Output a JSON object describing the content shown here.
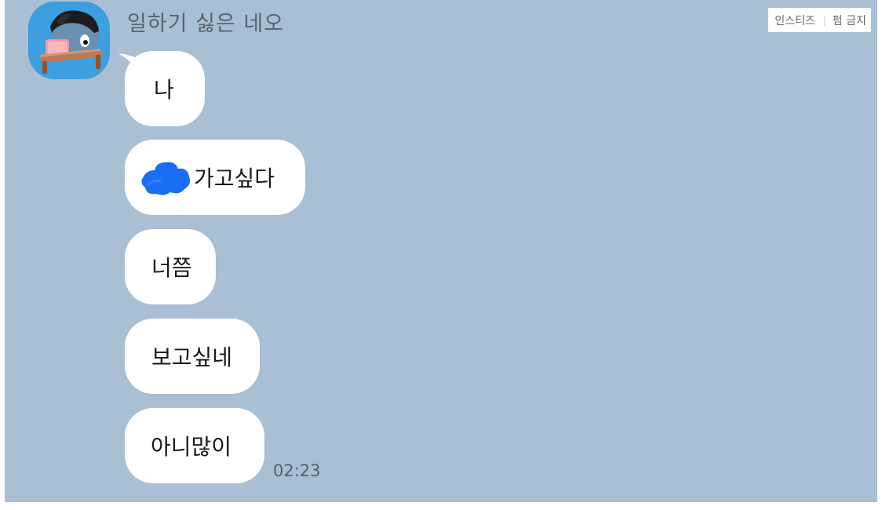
{
  "header": {
    "sender_name": "일하기 싫은 네오"
  },
  "watermark": {
    "left_text": "인스티즈",
    "divider": "|",
    "right_text": "펌 금지"
  },
  "messages": [
    {
      "text": "나"
    },
    {
      "text": "가고싶다",
      "prefix_icon": "blue-scribble-redaction"
    },
    {
      "text": "너쯤"
    },
    {
      "text": "보고싶네"
    },
    {
      "text": "아니많이"
    }
  ],
  "timestamp": "02:23",
  "colors": {
    "chat_background": "#a9c0d4",
    "bubble": "#ffffff",
    "avatar_background": "#3d9ee0",
    "redaction_blue": "#1a6ef2"
  },
  "icons": {
    "avatar": "neo-character-at-desk-avatar"
  }
}
